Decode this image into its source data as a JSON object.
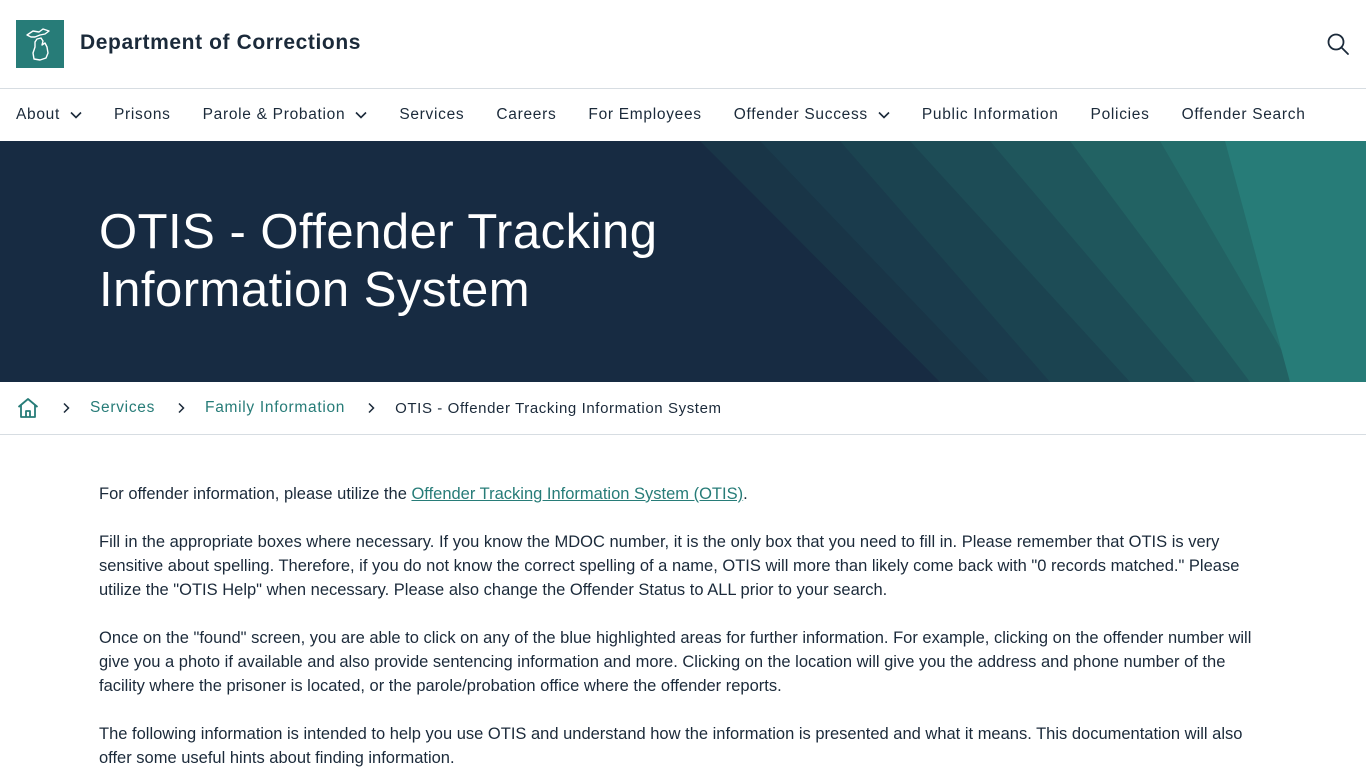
{
  "header": {
    "site_title": "Department of Corrections",
    "logo_icon": "michigan-map-icon",
    "search_icon": "search-icon"
  },
  "nav": {
    "items": [
      {
        "label": "About",
        "has_dropdown": true
      },
      {
        "label": "Prisons",
        "has_dropdown": false
      },
      {
        "label": "Parole & Probation",
        "has_dropdown": true
      },
      {
        "label": "Services",
        "has_dropdown": false
      },
      {
        "label": "Careers",
        "has_dropdown": false
      },
      {
        "label": "For Employees",
        "has_dropdown": false
      },
      {
        "label": "Offender Success",
        "has_dropdown": true
      },
      {
        "label": "Public Information",
        "has_dropdown": false
      },
      {
        "label": "Policies",
        "has_dropdown": false
      },
      {
        "label": "Offender Search",
        "has_dropdown": false
      }
    ]
  },
  "hero": {
    "title_line1": "OTIS - Offender Tracking",
    "title_line2": "Information System"
  },
  "breadcrumb": {
    "home_icon": "home-icon",
    "items": [
      "Services",
      "Family Information"
    ],
    "current": "OTIS - Offender Tracking Information System"
  },
  "content": {
    "p1_before": "For offender information, please utilize the ",
    "p1_link": "Offender Tracking Information System (OTIS)",
    "p1_after": ".",
    "p2": "Fill in the appropriate boxes where necessary.  If you know the MDOC number, it is the only box that you need to fill in.  Please remember that OTIS is very sensitive about spelling.  Therefore, if you do not know the correct spelling of a name, OTIS will more than likely come back with \"0 records matched.\" Please utilize the \"OTIS Help\" when necessary.  Please also change the Offender Status to ALL prior to your search.",
    "p3": "Once on the \"found\" screen, you are able to click on any of the blue highlighted areas for further information.  For example, clicking on the offender number will give you a photo if available and also provide sentencing information and more.  Clicking on the location will give you the address and phone number of the facility where the prisoner is located, or the parole/probation office where the offender reports.",
    "p4": "The following information is intended to help you use OTIS and understand how the information is presented and what it means. This documentation will also offer some useful hints about finding information."
  },
  "colors": {
    "brand_teal": "#277c78",
    "hero_navy": "#172b42",
    "text_dark": "#1b2a3a"
  }
}
